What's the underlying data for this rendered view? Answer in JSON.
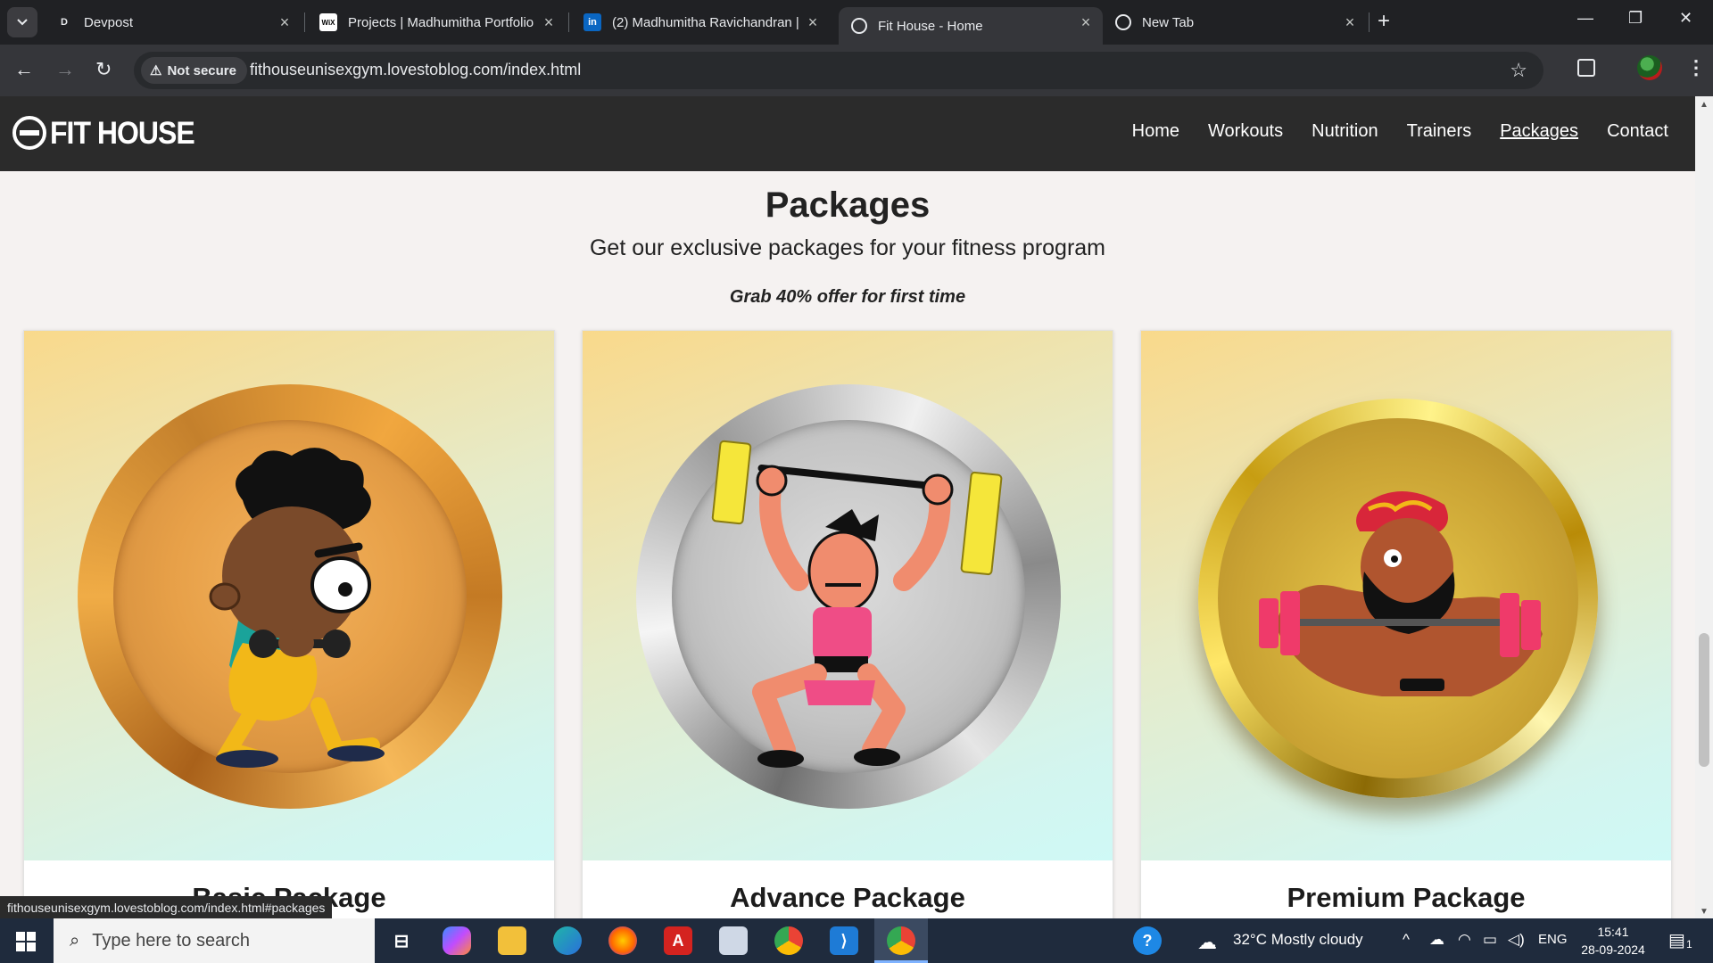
{
  "browser": {
    "tabs": [
      {
        "title": "Devpost",
        "favicon": "D"
      },
      {
        "title": "Projects | Madhumitha Portfolio",
        "favicon": "WiX"
      },
      {
        "title": "(2) Madhumitha Ravichandran |",
        "favicon": "in"
      },
      {
        "title": "Fit House - Home",
        "favicon": "globe"
      },
      {
        "title": "New Tab",
        "favicon": "chrome"
      }
    ],
    "security_label": "Not secure",
    "url": "fithouseunisexgym.lovestoblog.com/index.html",
    "status_url": "fithouseunisexgym.lovestoblog.com/index.html#packages"
  },
  "site": {
    "logo_text": "FIT HOUSE",
    "menu": [
      "Home",
      "Workouts",
      "Nutrition",
      "Trainers",
      "Packages",
      "Contact"
    ],
    "current_menu": "Packages"
  },
  "packages": {
    "heading": "Packages",
    "subheading": "Get our exclusive packages for your fitness program",
    "offer": "Grab 40% offer for first time",
    "cards": [
      {
        "title": "Basic Package",
        "medal": "bronze"
      },
      {
        "title": "Advance Package",
        "medal": "silver"
      },
      {
        "title": "Premium Package",
        "medal": "gold"
      }
    ]
  },
  "taskbar": {
    "search_placeholder": "Type here to search",
    "weather": "32°C  Mostly cloudy",
    "language": "ENG",
    "time": "15:41",
    "date": "28-09-2024",
    "notification_count": "1"
  },
  "colors": {
    "nav_bg": "#2b2b2b",
    "page_bg": "#f5f2f1",
    "taskbar_bg": "#1f2b3d",
    "chrome_bg": "#202124"
  }
}
